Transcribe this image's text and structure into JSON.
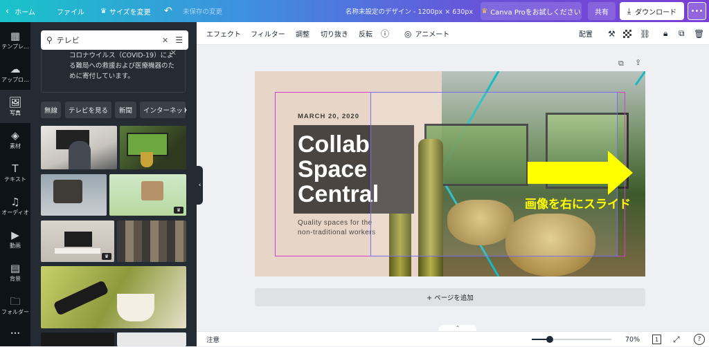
{
  "topbar": {
    "home": "ホーム",
    "file": "ファイル",
    "resize": "サイズを変更",
    "unsaved": "未保存の変更",
    "title": "名称未設定のデザイン - 1200px × 630px",
    "try_pro": "Canva Proをお試しください",
    "share": "共有",
    "download": "ダウンロード",
    "more": "•••"
  },
  "rail": [
    {
      "label": "テンプレ...",
      "icon": "template-icon"
    },
    {
      "label": "アップロ...",
      "icon": "upload-icon"
    },
    {
      "label": "写真",
      "icon": "photo-icon"
    },
    {
      "label": "素材",
      "icon": "elements-icon"
    },
    {
      "label": "テキスト",
      "icon": "text-icon"
    },
    {
      "label": "オーディオ",
      "icon": "audio-icon"
    },
    {
      "label": "動画",
      "icon": "video-icon"
    },
    {
      "label": "背景",
      "icon": "background-icon"
    },
    {
      "label": "フォルダー",
      "icon": "folder-icon"
    }
  ],
  "rail_more": "•••",
  "panel": {
    "search_value": "テレビ",
    "notice": "コロナウイルス（COVID-19）による難局への救援および医療機器のために寄付しています。",
    "chips": [
      "無線",
      "テレビを見る",
      "新聞",
      "インターネット"
    ]
  },
  "toolbar": {
    "effects": "エフェクト",
    "filter": "フィルター",
    "adjust": "調整",
    "crop": "切り抜き",
    "flip": "反転",
    "animate": "アニメート",
    "arrange": "配置"
  },
  "design": {
    "date": "MARCH 20, 2020",
    "line1": "Collab",
    "line2": "Space",
    "line3": "Central",
    "tagline1": "Quality spaces for the",
    "tagline2": "non-traditional workers",
    "annotation": "画像を右にスライド",
    "annotation_color": "#ffff00",
    "accent_teal": "#18b9c0",
    "selection_magenta": "#d63bd2"
  },
  "add_page": "+ ページを追加",
  "bottom": {
    "notes": "注意",
    "zoom": "70%",
    "zoom_level": 0.7,
    "page_count": "1",
    "help": "?"
  }
}
